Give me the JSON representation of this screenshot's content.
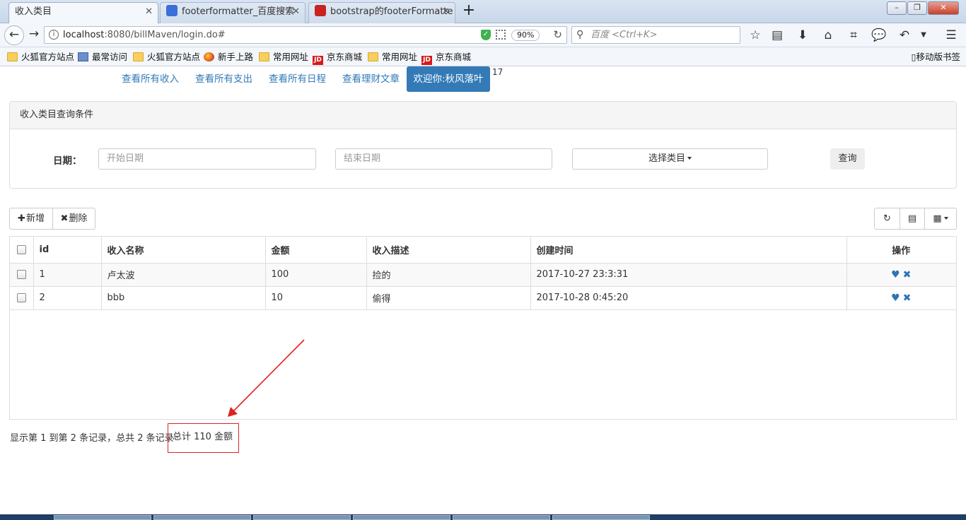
{
  "browser": {
    "tabs": [
      {
        "label": "收入类目",
        "active": true
      },
      {
        "label": "footerformatter_百度搜索",
        "active": false
      },
      {
        "label": "bootstrap的footerFormatte",
        "active": false
      }
    ],
    "url_host": "localhost",
    "url_rest": ":8080/billMaven/login.do#",
    "zoom": "90%",
    "search_placeholder": "百度 <Ctrl+K>",
    "bookmarks": [
      "火狐官方站点",
      "最常访问",
      "火狐官方站点",
      "新手上路",
      "常用网址",
      "京东商城",
      "常用网址",
      "京东商城"
    ],
    "mobile_bookmarks": "移动版书签"
  },
  "nav": {
    "links": [
      "查看所有收入",
      "查看所有支出",
      "查看所有日程",
      "查看理财文章"
    ],
    "welcome": "欢迎你:秋风落叶",
    "badge": "17"
  },
  "query_panel": {
    "title": "收入类目查询条件",
    "date_label": "日期：",
    "start_placeholder": "开始日期",
    "end_placeholder": "结束日期",
    "category_select": "选择类目",
    "query_button": "查询"
  },
  "toolbar": {
    "add_label": "新增",
    "delete_label": "删除"
  },
  "table": {
    "columns": [
      "id",
      "收入名称",
      "金额",
      "收入描述",
      "创建时间",
      "操作"
    ],
    "rows": [
      {
        "id": "1",
        "name": "卢太波",
        "amount": "100",
        "desc": "捡的",
        "created": "2017-10-27 23:3:31"
      },
      {
        "id": "2",
        "name": "bbb",
        "amount": "10",
        "desc": "偷得",
        "created": "2017-10-28 0:45:20"
      }
    ]
  },
  "footer": {
    "pagination_text": "显示第 1 到第 2 条记录，总共 2 条记录",
    "total_text": "总计 110 金额"
  },
  "colors": {
    "primary": "#337ab7",
    "annotation": "#d9252a"
  }
}
